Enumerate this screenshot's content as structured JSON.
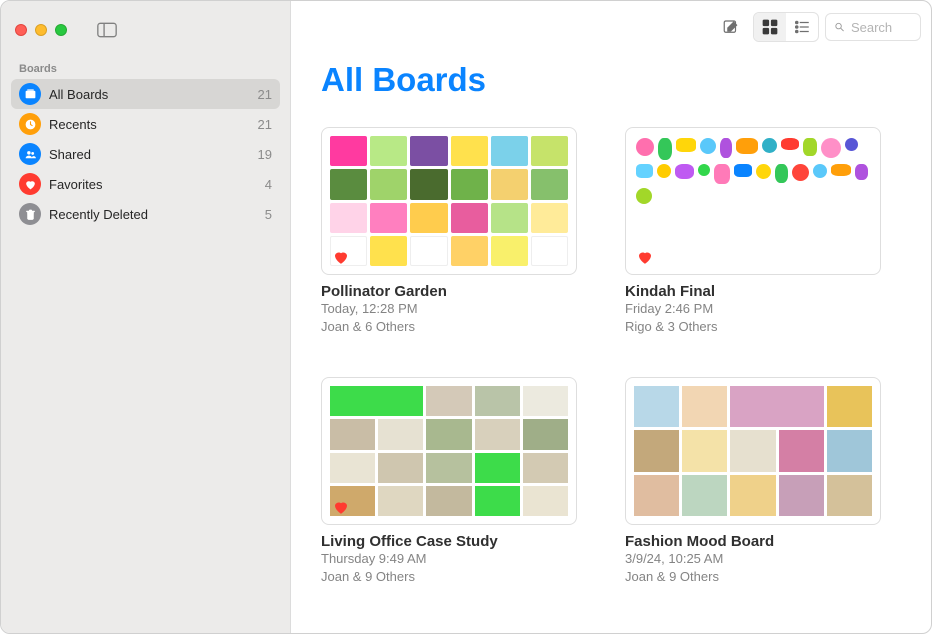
{
  "sidebar": {
    "header": "Boards",
    "items": [
      {
        "id": "all",
        "label": "All Boards",
        "count": "21",
        "icon": "boards",
        "selected": true
      },
      {
        "id": "recents",
        "label": "Recents",
        "count": "21",
        "icon": "clock",
        "selected": false
      },
      {
        "id": "shared",
        "label": "Shared",
        "count": "19",
        "icon": "people",
        "selected": false
      },
      {
        "id": "fav",
        "label": "Favorites",
        "count": "4",
        "icon": "heart",
        "selected": false
      },
      {
        "id": "trash",
        "label": "Recently Deleted",
        "count": "5",
        "icon": "trash",
        "selected": false
      }
    ]
  },
  "toolbar": {
    "compose_tooltip": "New Board",
    "view_grid_tooltip": "Grid",
    "view_list_tooltip": "List",
    "active_view": "grid",
    "search_placeholder": "Search"
  },
  "page": {
    "title": "All Boards"
  },
  "boards": [
    {
      "title": "Pollinator Garden",
      "timestamp": "Today, 12:28 PM",
      "participants": "Joan & 6 Others",
      "favorite": true
    },
    {
      "title": "Kindah Final",
      "timestamp": "Friday 2:46 PM",
      "participants": "Rigo & 3 Others",
      "favorite": true
    },
    {
      "title": "Living Office Case Study",
      "timestamp": "Thursday 9:49 AM",
      "participants": "Joan & 9 Others",
      "favorite": true
    },
    {
      "title": "Fashion Mood Board",
      "timestamp": "3/9/24, 10:25 AM",
      "participants": "Joan & 9 Others",
      "favorite": false
    }
  ]
}
